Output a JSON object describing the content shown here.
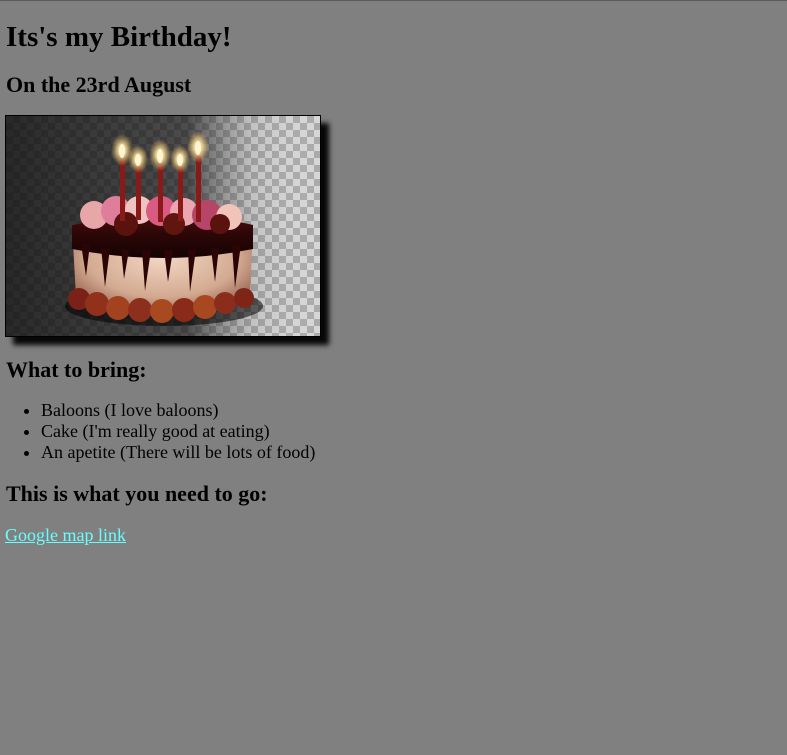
{
  "page": {
    "title": "Its's my Birthday!",
    "date_heading": "On the 23rd August",
    "bring_heading": "What to bring:",
    "go_heading": "This is what you need to go:",
    "colors": {
      "background": "#808080",
      "link": "#66ffff",
      "text": "#000000"
    }
  },
  "image": {
    "icon": "birthday-cake-image"
  },
  "bring_list": [
    "Baloons (I love baloons)",
    "Cake (I'm really good at eating)",
    "An apetite (There will be lots of food)"
  ],
  "link": {
    "label": "Google map link"
  }
}
